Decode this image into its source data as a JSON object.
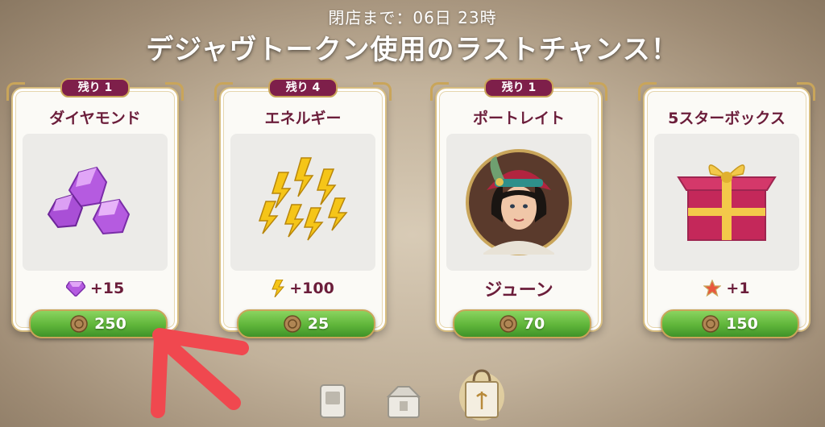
{
  "header": {
    "timer": "閉店まで：06日 23時",
    "headline": "デジャヴトークン使用のラストチャンス！"
  },
  "offers": [
    {
      "badge": "残り 1",
      "title": "ダイヤモンド",
      "amount_icon": "diamond-icon",
      "amount": "+15",
      "price": "250"
    },
    {
      "badge": "残り 4",
      "title": "エネルギー",
      "amount_icon": "lightning-icon",
      "amount": "+100",
      "price": "25"
    },
    {
      "badge": "残り 1",
      "title": "ポートレイト",
      "amount": "ジューン",
      "price": "70"
    },
    {
      "badge": "",
      "title": "5スターボックス",
      "amount_icon": "star-icon",
      "amount": "+1",
      "price": "150"
    }
  ],
  "colors": {
    "badge": "#7e1f4a",
    "title_text": "#6b1d3a",
    "price_button": "#5fb53a",
    "annotation_arrow": "#f0484f"
  },
  "bottom_nav": [
    "card-tab-icon",
    "box-tab-icon",
    "shopping-bag-tab-icon"
  ]
}
